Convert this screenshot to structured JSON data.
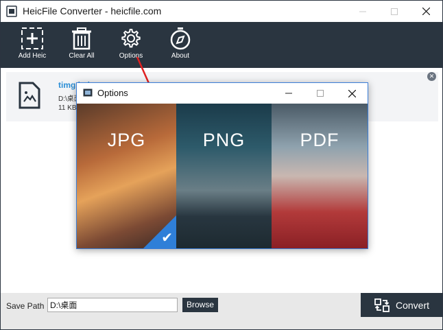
{
  "window": {
    "title": "HeicFile Converter - heicfile.com"
  },
  "toolbar": {
    "add_label": "Add Heic",
    "clear_label": "Clear All",
    "options_label": "Options",
    "about_label": "About"
  },
  "file": {
    "name": "timg.heic",
    "path": "D:\\桌面",
    "size": "11 KB"
  },
  "bottom": {
    "save_path_label": "Save Path",
    "save_path_value": "D:\\桌面",
    "browse_label": "Browse",
    "convert_label": "Convert"
  },
  "dialog": {
    "title": "Options",
    "formats": [
      {
        "label": "JPG",
        "selected": true
      },
      {
        "label": "PNG",
        "selected": false
      },
      {
        "label": "PDF",
        "selected": false
      }
    ]
  },
  "colors": {
    "toolbar_bg": "#2a3540",
    "accent_blue": "#2f7fd8",
    "file_name": "#2b8ed6",
    "pointer_arrow": "#e02020"
  }
}
